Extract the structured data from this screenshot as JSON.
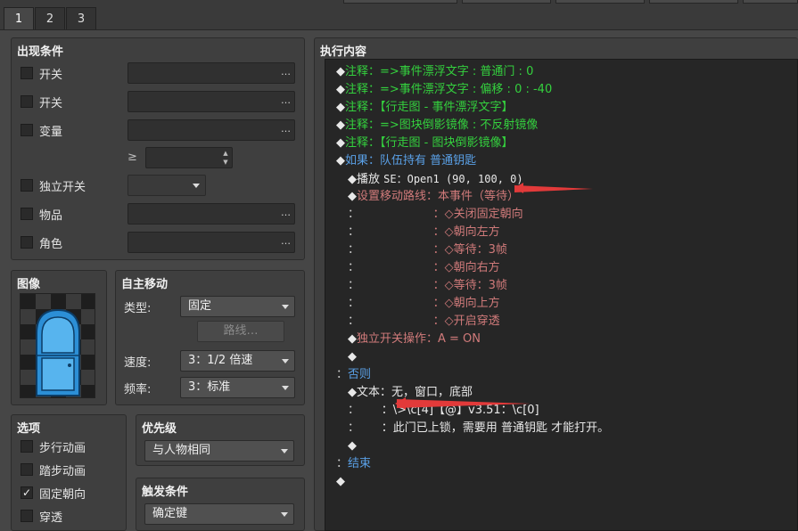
{
  "tabs": [
    {
      "label": "1",
      "active": true
    },
    {
      "label": "2",
      "active": false
    },
    {
      "label": "3",
      "active": false
    }
  ],
  "conditions": {
    "title": "出现条件",
    "switch1": {
      "label": "开关",
      "checked": false
    },
    "switch2": {
      "label": "开关",
      "checked": false
    },
    "variable": {
      "label": "变量",
      "checked": false
    },
    "ge_symbol": "≥",
    "self_switch": {
      "label": "独立开关",
      "checked": false
    },
    "item": {
      "label": "物品",
      "checked": false
    },
    "actor": {
      "label": "角色",
      "checked": false
    },
    "dots": "…"
  },
  "image": {
    "title": "图像"
  },
  "autonomous": {
    "title": "自主移动",
    "type_label": "类型:",
    "type_value": "固定",
    "route_button": "路线…",
    "speed_label": "速度:",
    "speed_value": "3：1/2 倍速",
    "freq_label": "频率:",
    "freq_value": "3：标准"
  },
  "options": {
    "title": "选项",
    "walking": {
      "label": "步行动画",
      "checked": false
    },
    "stepping": {
      "label": "踏步动画",
      "checked": false
    },
    "direction_fix": {
      "label": "固定朝向",
      "checked": true
    },
    "through": {
      "label": "穿透",
      "checked": false
    },
    "check_mark": "✓"
  },
  "priority": {
    "title": "优先级",
    "value": "与人物相同"
  },
  "trigger": {
    "title": "触发条件",
    "value": "确定键"
  },
  "contents": {
    "title": "执行内容",
    "lines": [
      {
        "indent": 0,
        "segments": [
          {
            "t": "◆",
            "c": "white"
          },
          {
            "t": "注释：=>事件漂浮文字 : 普通门 : 0",
            "c": "green"
          }
        ]
      },
      {
        "indent": 0,
        "segments": [
          {
            "t": "◆",
            "c": "white"
          },
          {
            "t": "注释：=>事件漂浮文字 : 偏移 : 0 : -40",
            "c": "green"
          }
        ]
      },
      {
        "indent": 0,
        "segments": [
          {
            "t": "◆",
            "c": "white"
          },
          {
            "t": "注释：【行走图 - 事件漂浮文字】",
            "c": "green"
          }
        ]
      },
      {
        "indent": 0,
        "segments": [
          {
            "t": "◆",
            "c": "white"
          },
          {
            "t": "注释：=>图块倒影镜像 : 不反射镜像",
            "c": "green"
          }
        ]
      },
      {
        "indent": 0,
        "segments": [
          {
            "t": "◆",
            "c": "white"
          },
          {
            "t": "注释：【行走图 - 图块倒影镜像】",
            "c": "green"
          }
        ]
      },
      {
        "indent": 0,
        "segments": [
          {
            "t": "◆",
            "c": "white"
          },
          {
            "t": "如果：队伍持有 普通钥匙",
            "c": "blue"
          }
        ]
      },
      {
        "indent": 1,
        "segments": [
          {
            "t": "◆播放 ",
            "c": "white"
          },
          {
            "t": "SE：Open1 (90, 100, 0)",
            "c": "white",
            "mono": true
          }
        ]
      },
      {
        "indent": 1,
        "segments": [
          {
            "t": "◆",
            "c": "white"
          },
          {
            "t": "设置移动路线：本事件（等待）",
            "c": "red"
          }
        ]
      },
      {
        "indent": 1,
        "segments": [
          {
            "t": "：",
            "c": "gray"
          },
          {
            "t": "                    ：◇关闭固定朝向",
            "c": "red"
          }
        ]
      },
      {
        "indent": 1,
        "segments": [
          {
            "t": "：",
            "c": "gray"
          },
          {
            "t": "                    ：◇朝向左方",
            "c": "red"
          }
        ]
      },
      {
        "indent": 1,
        "segments": [
          {
            "t": "：",
            "c": "gray"
          },
          {
            "t": "                    ：◇等待：3帧",
            "c": "red"
          }
        ]
      },
      {
        "indent": 1,
        "segments": [
          {
            "t": "：",
            "c": "gray"
          },
          {
            "t": "                    ：◇朝向右方",
            "c": "red"
          }
        ]
      },
      {
        "indent": 1,
        "segments": [
          {
            "t": "：",
            "c": "gray"
          },
          {
            "t": "                    ：◇等待：3帧",
            "c": "red"
          }
        ]
      },
      {
        "indent": 1,
        "segments": [
          {
            "t": "：",
            "c": "gray"
          },
          {
            "t": "                    ：◇朝向上方",
            "c": "red"
          }
        ]
      },
      {
        "indent": 1,
        "segments": [
          {
            "t": "：",
            "c": "gray"
          },
          {
            "t": "                    ：◇开启穿透",
            "c": "red"
          }
        ]
      },
      {
        "indent": 1,
        "segments": [
          {
            "t": "◆",
            "c": "white"
          },
          {
            "t": "独立开关操作：A = ON",
            "c": "red"
          }
        ]
      },
      {
        "indent": 1,
        "segments": [
          {
            "t": "◆",
            "c": "white"
          }
        ]
      },
      {
        "indent": 0,
        "segments": [
          {
            "t": "：",
            "c": "gray"
          },
          {
            "t": "否则",
            "c": "blue"
          }
        ]
      },
      {
        "indent": 1,
        "segments": [
          {
            "t": "◆文本",
            "c": "white"
          },
          {
            "t": "：无，窗口，底部",
            "c": "white"
          }
        ]
      },
      {
        "indent": 1,
        "segments": [
          {
            "t": "：",
            "c": "gray"
          },
          {
            "t": "      ：\\>\\c[4]【@】v3.51：\\c[0]",
            "c": "white"
          }
        ]
      },
      {
        "indent": 1,
        "segments": [
          {
            "t": "：",
            "c": "gray"
          },
          {
            "t": "      ：此门已上锁，需要用 普通钥匙 才能打开。",
            "c": "white"
          }
        ]
      },
      {
        "indent": 1,
        "segments": [
          {
            "t": "◆",
            "c": "white"
          }
        ]
      },
      {
        "indent": 0,
        "segments": [
          {
            "t": "：",
            "c": "gray"
          },
          {
            "t": "结束",
            "c": "blue"
          }
        ]
      },
      {
        "indent": 0,
        "segments": [
          {
            "t": "◆",
            "c": "white"
          }
        ]
      }
    ]
  },
  "colors": {
    "comment": "#34d13e",
    "branch": "#5aa0e6",
    "move": "#d07a7a",
    "arrow": "#e23a3a"
  }
}
